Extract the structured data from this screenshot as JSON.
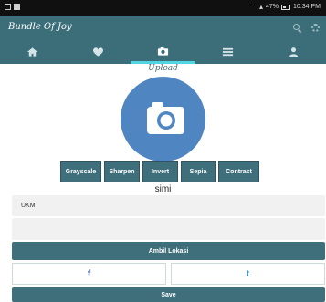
{
  "status_bar": {
    "time": "10:34 PM",
    "battery": "47%"
  },
  "app": {
    "title": "Bundle Of Joy"
  },
  "header_icons": [
    "search-icon",
    "settings-icon"
  ],
  "tabs": [
    {
      "icon": "home-icon",
      "active": false
    },
    {
      "icon": "heart-icon",
      "active": false
    },
    {
      "icon": "camera-icon",
      "active": true
    },
    {
      "icon": "list-icon",
      "active": false
    },
    {
      "icon": "profile-icon",
      "active": false
    }
  ],
  "upload": {
    "label": "Upload",
    "icon": "camera-icon"
  },
  "filters": [
    "Grayscale",
    "Sharpen",
    "Invert",
    "Sepia",
    "Contrast"
  ],
  "photo_caption": "simi",
  "form": {
    "location_value": "UKM",
    "second_field_value": ""
  },
  "buttons": {
    "location": "Ambil Lokasi",
    "save": "Save"
  },
  "social": {
    "facebook": "f",
    "twitter": "t"
  },
  "colors": {
    "primary": "#3c6e7a",
    "tab_indicator": "#52d4e3",
    "camera_circle": "#4f86c2"
  }
}
